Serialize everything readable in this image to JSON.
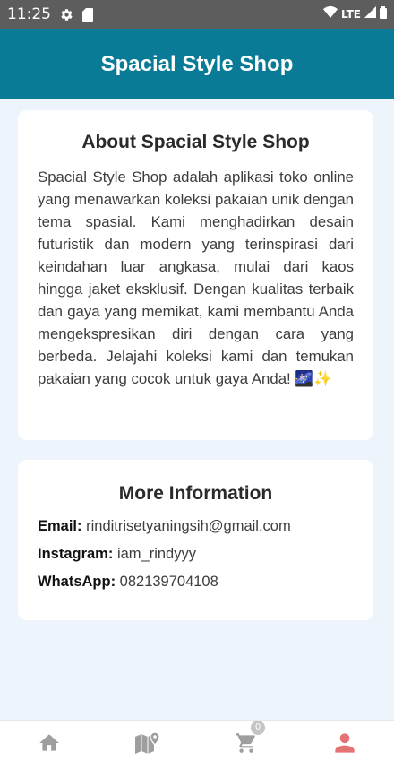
{
  "status_bar": {
    "time": "11:25",
    "network": "LTE",
    "icons": [
      "settings-icon",
      "sim-card-icon",
      "wifi-icon",
      "signal-icon",
      "battery-icon"
    ]
  },
  "app_bar": {
    "title": "Spacial Style Shop",
    "color": "#0a7b96"
  },
  "about": {
    "title": "About Spacial Style Shop",
    "text": "Spacial Style Shop adalah aplikasi toko online yang menawarkan koleksi pakaian unik dengan tema spasial. Kami menghadirkan desain futuristik dan modern yang terinspirasi dari keindahan luar angkasa, mulai dari kaos hingga jaket eksklusif. Dengan kualitas terbaik dan gaya yang memikat, kami membantu Anda mengekspresikan diri dengan cara yang berbeda. Jelajahi koleksi kami dan temukan pakaian yang cocok untuk gaya Anda! 🌌✨"
  },
  "info": {
    "title": "More Information",
    "email_label": "Email:",
    "email": "rinditrisetyaningsih@gmail.com",
    "instagram_label": "Instagram:",
    "instagram": "iam_rindyyy",
    "whatsapp_label": "WhatsApp:",
    "whatsapp": "082139704108"
  },
  "bottom_nav": {
    "items": [
      "home-icon",
      "map-icon",
      "cart-icon",
      "person-icon"
    ],
    "cart_count": "0",
    "active_item": "person-icon",
    "active_color": "#e57373",
    "inactive_color": "#9e9e9e"
  }
}
